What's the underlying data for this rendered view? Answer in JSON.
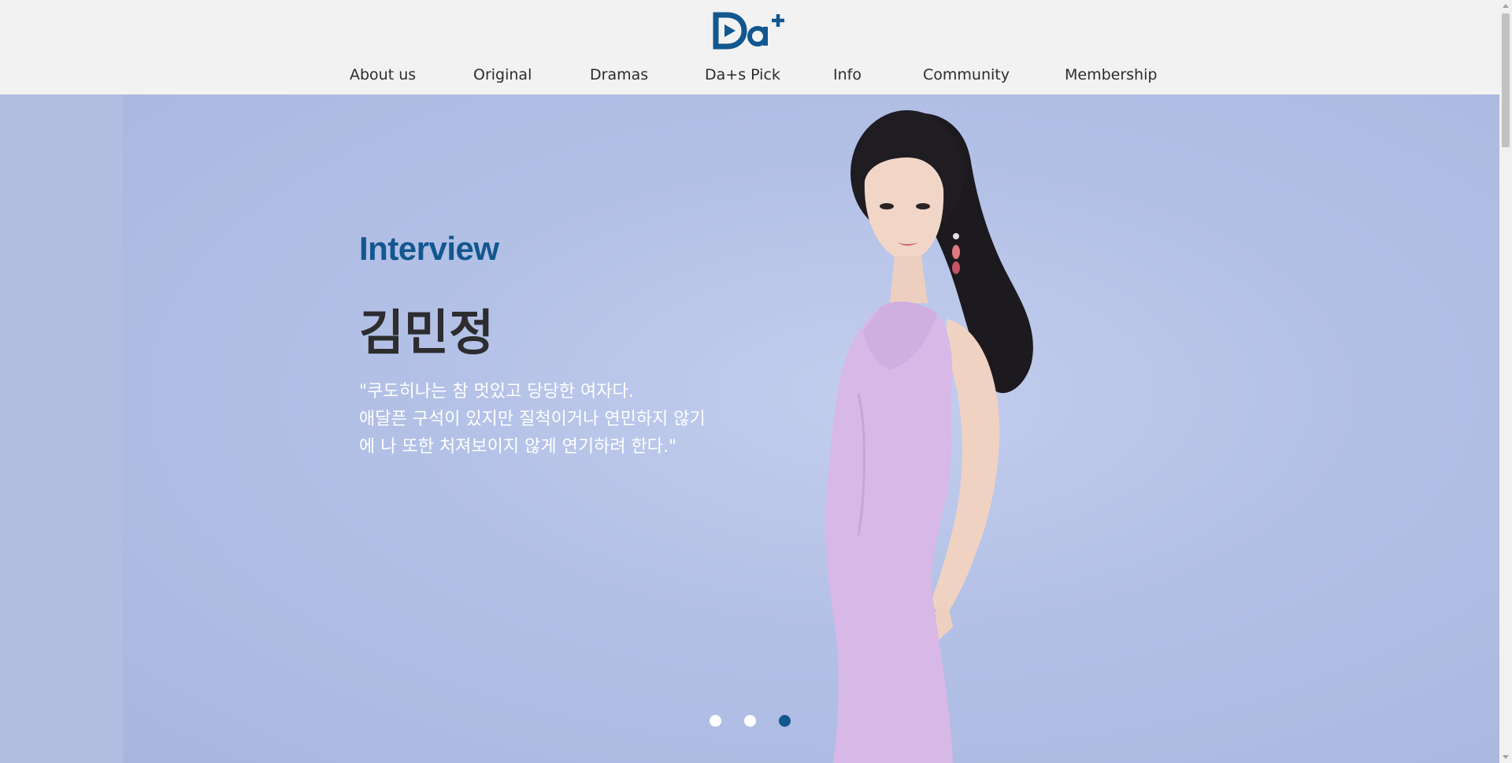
{
  "header": {
    "logo_alt": "Da+",
    "nav": [
      {
        "label": "About us"
      },
      {
        "label": "Original"
      },
      {
        "label": "Dramas"
      },
      {
        "label": "Da+s Pick"
      },
      {
        "label": "Info"
      },
      {
        "label": "Community"
      },
      {
        "label": "Membership"
      }
    ]
  },
  "hero": {
    "kicker": "Interview",
    "headline": "김민정",
    "quote_lines": [
      "\"쿠도히나는 참 멋있고 당당한 여자다.",
      "애달픈 구석이 있지만 질척이거나 연민하지 않기",
      "에 나 또한 처져보이지 않게 연기하려 한다.\""
    ],
    "slides": {
      "count": 3,
      "active_index": 2
    }
  },
  "colors": {
    "brand": "#13578f",
    "header_bg": "#f1f2f1",
    "hero_bg": "#b6c0e2",
    "dress": "#d7b8e6"
  }
}
